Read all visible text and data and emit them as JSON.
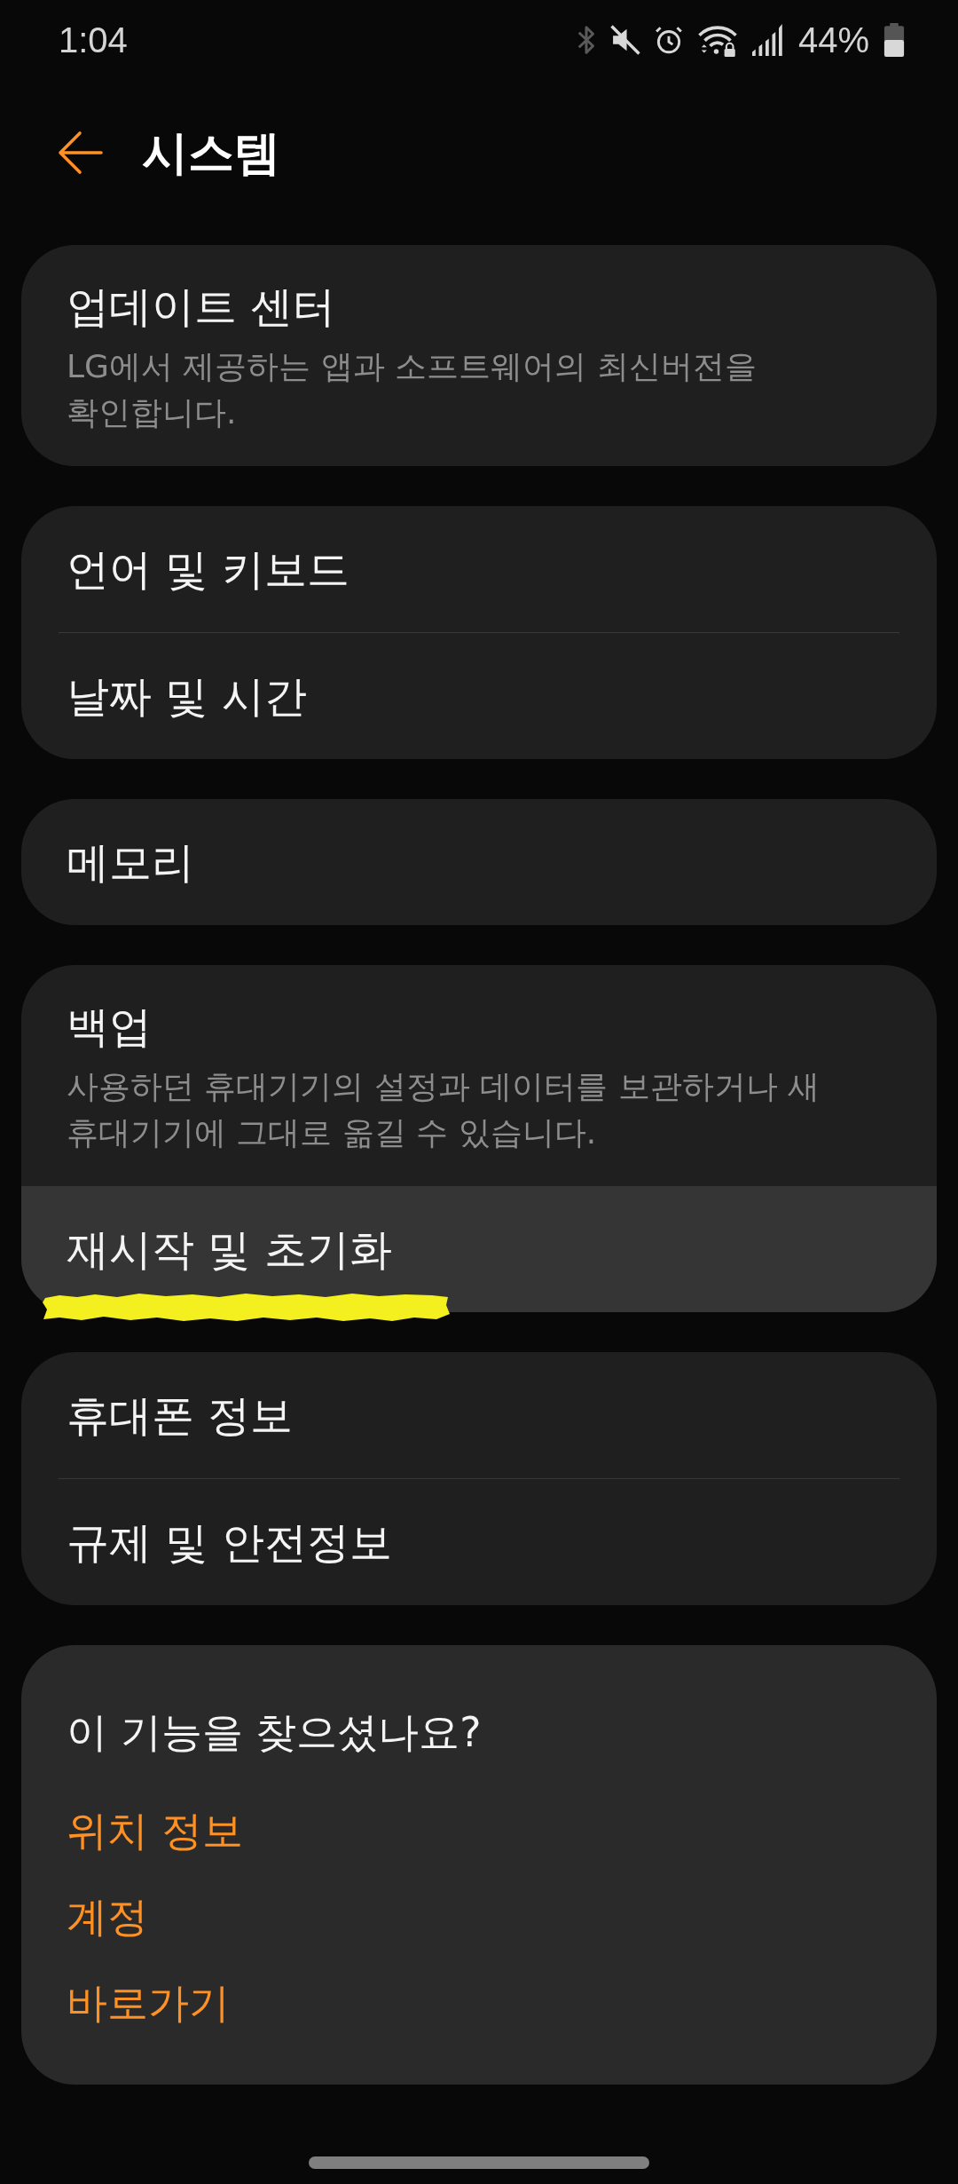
{
  "status_bar": {
    "time": "1:04",
    "battery": "44%"
  },
  "header": {
    "title": "시스템"
  },
  "groups": [
    {
      "items": [
        {
          "title": "업데이트 센터",
          "description": "LG에서 제공하는 앱과 소프트웨어의 최신버전을 확인합니다.",
          "pressed": false,
          "marked": false
        }
      ]
    },
    {
      "items": [
        {
          "title": "언어 및 키보드",
          "pressed": false,
          "marked": false
        },
        {
          "title": "날짜 및 시간",
          "pressed": false,
          "marked": false
        }
      ]
    },
    {
      "items": [
        {
          "title": "메모리",
          "pressed": false,
          "marked": false
        }
      ]
    },
    {
      "items": [
        {
          "title": "백업",
          "description": "사용하던 휴대기기의 설정과 데이터를 보관하거나 새 휴대기기에 그대로 옮길 수 있습니다.",
          "pressed": false,
          "marked": false
        },
        {
          "title": "재시작 및 초기화",
          "pressed": true,
          "marked": true
        }
      ]
    },
    {
      "items": [
        {
          "title": "휴대폰 정보",
          "pressed": false,
          "marked": false
        },
        {
          "title": "규제 및 안전정보",
          "pressed": false,
          "marked": false
        }
      ]
    }
  ],
  "suggestions": {
    "title": "이 기능을 찾으셨나요?",
    "links": [
      "위치 정보",
      "계정",
      "바로가기"
    ]
  }
}
